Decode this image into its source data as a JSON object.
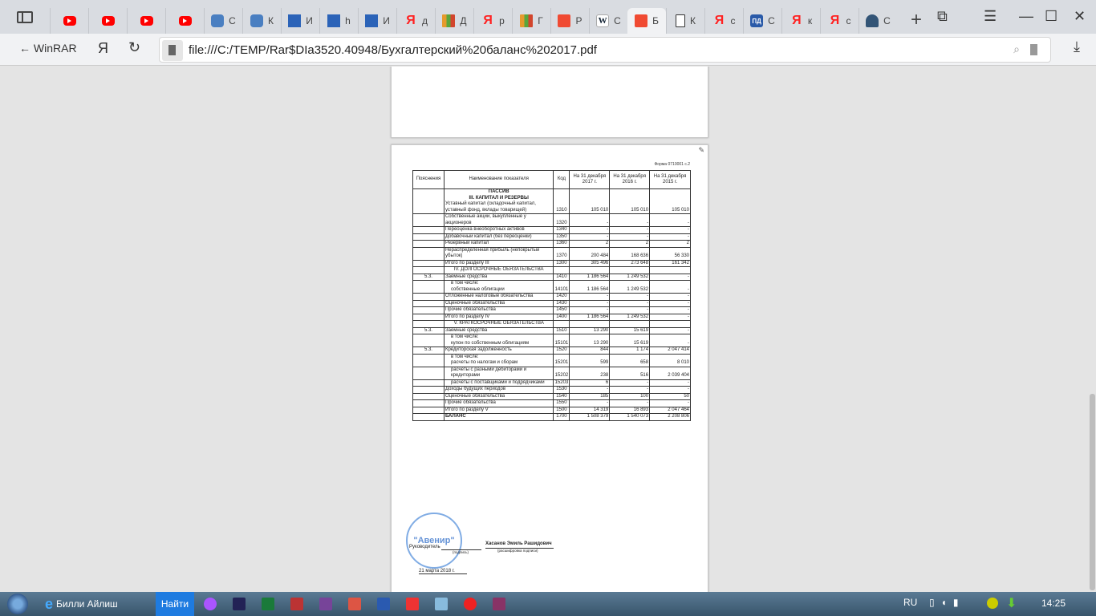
{
  "tabs": [
    {
      "icon": "youtube-icon",
      "label": ""
    },
    {
      "icon": "youtube-icon",
      "label": ""
    },
    {
      "icon": "youtube-icon",
      "label": ""
    },
    {
      "icon": "youtube-icon",
      "label": ""
    },
    {
      "icon": "chat-icon",
      "label": "С"
    },
    {
      "icon": "chat-icon",
      "label": "К"
    },
    {
      "icon": "blue-plus-icon",
      "label": "И"
    },
    {
      "icon": "blue-plus-icon",
      "label": "h"
    },
    {
      "icon": "blue-plus-icon",
      "label": "И"
    },
    {
      "icon": "yandex-icon",
      "label": "д"
    },
    {
      "icon": "books-icon",
      "label": "Д"
    },
    {
      "icon": "yandex-icon",
      "label": "р"
    },
    {
      "icon": "books-icon",
      "label": "Г"
    },
    {
      "icon": "shield-pdf-icon",
      "label": "Р"
    },
    {
      "icon": "wikipedia-icon",
      "label": "С"
    },
    {
      "icon": "shield-pdf-icon",
      "label": "Б",
      "active": true
    },
    {
      "icon": "document-icon",
      "label": "К"
    },
    {
      "icon": "yandex-icon",
      "label": "с"
    },
    {
      "icon": "pd-icon",
      "label": "С"
    },
    {
      "icon": "yandex-icon",
      "label": "к"
    },
    {
      "icon": "yandex-icon",
      "label": "с"
    },
    {
      "icon": "people-icon",
      "label": "С"
    }
  ],
  "nav": {
    "back_label": "WinRAR",
    "yandex": "Я",
    "url": "file:///C:/TEMP/Rar$DIa3520.40948/Бухгалтерский%20баланс%202017.pdf"
  },
  "doc": {
    "forma": "Форма 0710001 с.2",
    "headers": [
      "Пояснения",
      "Наименование показателя",
      "Код",
      "На 31 декабря 2017 г.",
      "На 31 декабря 2016 г.",
      "На 31 декабря 2015 г."
    ],
    "rows": [
      {
        "pre": [
          "ПАССИВ",
          "III. КАПИТАЛ И РЕЗЕРВЫ"
        ],
        "name": "Уставный капитал (складочный капитал, уставный фонд, вклады товарищей)",
        "code": "1310",
        "v": [
          "105 010",
          "105 010",
          "105 010"
        ]
      },
      {
        "name": "Собственные акции, выкупленные у акционеров",
        "code": "1320",
        "v": [
          "-",
          "-",
          "-"
        ]
      },
      {
        "name": "Переоценка внеоборотных активов",
        "code": "1340",
        "v": [
          "-",
          "-",
          "-"
        ]
      },
      {
        "name": "Добавочный капитал (без переоценки)",
        "code": "1350",
        "v": [
          "-",
          "-",
          "-"
        ]
      },
      {
        "name": "Резервный капитал",
        "code": "1360",
        "v": [
          "2",
          "2",
          "2"
        ]
      },
      {
        "name": "Нераспределенная прибыль (непокрытый убыток)",
        "code": "1370",
        "v": [
          "200 484",
          "168 636",
          "56 330"
        ]
      },
      {
        "name": "Итого по разделу III",
        "code": "1300",
        "v": [
          "305 496",
          "273 648",
          "161 342"
        ]
      },
      {
        "heading": "IV. ДОЛГОСРОЧНЫЕ ОБЯЗАТЕЛЬСТВА"
      },
      {
        "note": "5.3.",
        "name": "Заемные средства",
        "code": "1410",
        "v": [
          "1 186 564",
          "1 249 532",
          "-"
        ]
      },
      {
        "sub": "в том числе:",
        "name": "собственные облигации",
        "code": "14101",
        "v": [
          "1 186 564",
          "1 249 532",
          "-"
        ],
        "indent": true
      },
      {
        "name": "Отложенные налоговые обязательства",
        "code": "1420",
        "v": [
          "-",
          "-",
          "-"
        ]
      },
      {
        "name": "Оценочные обязательства",
        "code": "1430",
        "v": [
          "-",
          "-",
          "-"
        ]
      },
      {
        "name": "Прочие обязательства",
        "code": "1450",
        "v": [
          "-",
          "-",
          "-"
        ]
      },
      {
        "name": "Итого по разделу IV",
        "code": "1400",
        "v": [
          "1 186 564",
          "1 249 532",
          "-"
        ]
      },
      {
        "heading": "V. КРАТКОСРОЧНЫЕ ОБЯЗАТЕЛЬСТВА"
      },
      {
        "note": "5.3.",
        "name": "Заемные средства",
        "code": "1510",
        "v": [
          "13 290",
          "15 619",
          "-"
        ]
      },
      {
        "sub": "в том числе:",
        "name": "купон по собственным облигациям",
        "code": "15101",
        "v": [
          "13 290",
          "15 619",
          "-"
        ],
        "indent": true
      },
      {
        "note": "5.3.",
        "name": "Кредиторская задолженность",
        "code": "1520",
        "v": [
          "844",
          "1 174",
          "2 047 414"
        ]
      },
      {
        "sub": "в том числе:",
        "name": "расчеты по налогам и сборам",
        "code": "15201",
        "v": [
          "599",
          "658",
          "8 010"
        ],
        "indent": true
      },
      {
        "name": "расчеты с разными дебиторами и кредиторами",
        "code": "15202",
        "v": [
          "238",
          "516",
          "2 039 404"
        ],
        "indent": true
      },
      {
        "name": "расчеты с поставщиками и подрядчиками",
        "code": "15203",
        "v": [
          "6",
          "-",
          "-"
        ],
        "indent": true
      },
      {
        "name": "Доходы будущих периодов",
        "code": "1530",
        "v": [
          "-",
          "-",
          "-"
        ]
      },
      {
        "name": "Оценочные обязательства",
        "code": "1540",
        "v": [
          "185",
          "100",
          "50"
        ]
      },
      {
        "name": "Прочие обязательства",
        "code": "1550",
        "v": [
          "-",
          "-",
          "-"
        ]
      },
      {
        "name": "Итого по разделу V",
        "code": "1500",
        "v": [
          "14 319",
          "16 893",
          "2 047 464"
        ]
      },
      {
        "name": "БАЛАНС",
        "code": "1700",
        "v": [
          "1 508 379",
          "1 540 073",
          "2 208 806"
        ],
        "bold": true
      }
    ],
    "signature": {
      "role": "Руководитель",
      "sign_caption": "(подпись)",
      "name": "Хасанов Эмиль Рашидович",
      "name_caption": "(расшифровка подписи)",
      "date": "21 марта 2018 г.",
      "stamp": "\"Авенир\""
    }
  },
  "taskbar": {
    "ie_label": "Билли Айлиш",
    "search_label": "Найти",
    "lang": "RU",
    "time": "14:25",
    "apps": [
      "alice-icon",
      "save-icon",
      "excel-icon",
      "acrobat-icon",
      "onenote-icon",
      "ppt-icon",
      "word-icon",
      "yandex-icon",
      "calculator-icon",
      "yandex-browser-icon",
      "winrar-icon"
    ]
  }
}
